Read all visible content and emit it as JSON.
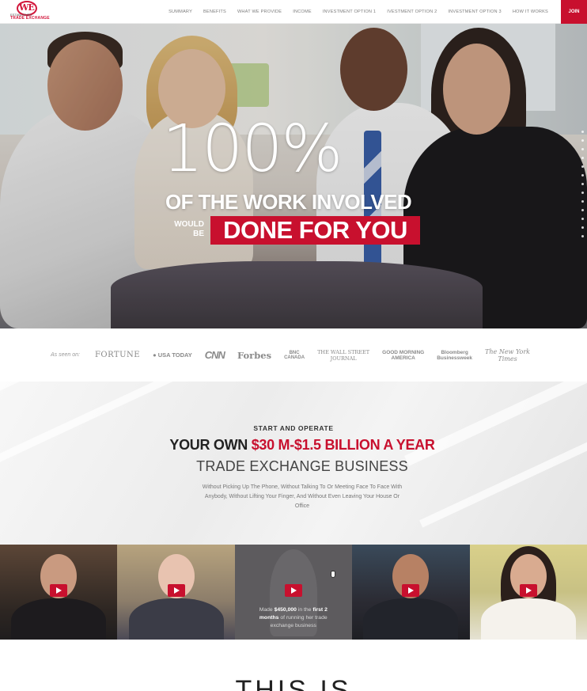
{
  "nav": {
    "logo_text": "WE",
    "logo_brand": "TRADE EXCHANGE",
    "logo_since": "ESTABLISHED",
    "items": [
      "SUMMARY",
      "BENEFITS",
      "WHAT WE PROVIDE",
      "INCOME",
      "INVESTMENT OPTION 1",
      "IVESTMENT OPTION 2",
      "INVESTMENT OPTION 3",
      "HOW IT WORKS"
    ],
    "join_label": "JOIN",
    "accent_color": "#c8102e"
  },
  "hero": {
    "big_number": "100%",
    "line1": "OF THE WORK INVOLVED",
    "would_be_1": "WOULD",
    "would_be_2": "BE",
    "highlight": "DONE FOR YOU"
  },
  "press": {
    "label": "As seen on:",
    "logos": {
      "fortune": "FORTUNE",
      "usatoday": "USA TODAY",
      "cnn": "CNN",
      "forbes": "Forbes",
      "bnc_1": "BNC",
      "bnc_2": "CANADA",
      "wsj_1": "THE WALL STREET",
      "wsj_2": "JOURNAL",
      "gma_1": "GOOD MORNING",
      "gma_2": "AMERICA",
      "bloom_1": "Bloomberg",
      "bloom_2": "Businessweek",
      "nyt_1": "The New York",
      "nyt_2": "Times"
    }
  },
  "start": {
    "kicker": "START AND OPERATE",
    "headline_prefix": "YOUR OWN ",
    "headline_amount": "$30 M-$1.5 BILLION A YEAR",
    "subheadline": "TRADE EXCHANGE BUSINESS",
    "description": "Without Picking Up The Phone, Without Talking To Or Meeting Face To Face With Anybody, Without Lifting Your Finger, And Without Even Leaving Your House Or Office"
  },
  "videos": {
    "caption_pre": "Made ",
    "caption_amount": "$450,000",
    "caption_mid": " in the ",
    "caption_period": "first 2 months",
    "caption_post": " of running her trade exchange business"
  },
  "bottom": {
    "title": "THIS IS"
  }
}
